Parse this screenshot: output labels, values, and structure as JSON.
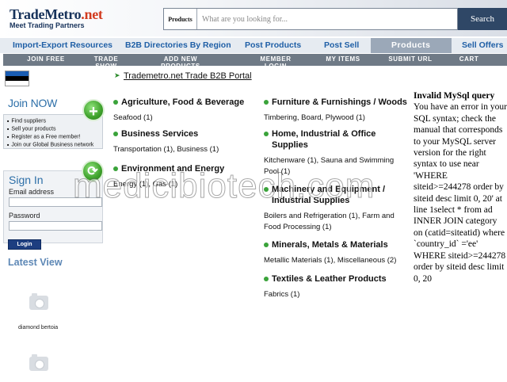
{
  "header": {
    "logo_main": "TradeMetro",
    "logo_dot": ".net",
    "tagline": "Meet Trading Partners",
    "search_category": "Products",
    "search_placeholder": "What are you looking for...",
    "search_button": "Search"
  },
  "nav_primary": [
    {
      "label": "Import-Export Resources",
      "active": false
    },
    {
      "label": "B2B Directories By Region",
      "active": false
    },
    {
      "label": "Post Products",
      "active": false
    },
    {
      "label": "Post Sell",
      "active": false
    },
    {
      "label": "Products",
      "active": true
    },
    {
      "label": "Sell Offers",
      "active": false
    }
  ],
  "nav_secondary": [
    "JOIN FREE",
    "TRADE SHOW",
    "ADD NEW PRODUCTS",
    "MEMBER LOGIN",
    "MY ITEMS",
    "SUBMIT URL",
    "CART"
  ],
  "breadcrumb": "Trademetro.net Trade B2B Portal",
  "flag_colors": [
    "#1a5db3",
    "#000000",
    "#ffffff"
  ],
  "sidebar": {
    "join_title": "Join NOW",
    "join_items": [
      "Find suppliers",
      "Sell your products",
      "Register as a Free member!",
      "Join our Global Business network"
    ],
    "signin_title": "Sign In",
    "email_label": "Email address",
    "password_label": "Password",
    "login_button": "Login",
    "latest_title": "Latest View",
    "latest_item": "diamond bertoia"
  },
  "categories_left": [
    {
      "title": "Agriculture, Food & Beverage",
      "sub": "Seafood (1)"
    },
    {
      "title": "Business Services",
      "sub": "Transportation (1), Business (1)"
    },
    {
      "title": "Environment and Energy",
      "sub": "Energy (1), Gas (1)"
    }
  ],
  "categories_right": [
    {
      "title": "Furniture & Furnishings / Woods",
      "sub": "Timbering, Board, Plywood (1)"
    },
    {
      "title": "Home, Industrial & Office Supplies",
      "sub": "Kitchenware (1), Sauna and Swimming Pool (1)"
    },
    {
      "title": "Machinery and Equipment / Industrial Supplies",
      "sub": "Boilers and Refrigeration (1), Farm and Food Processing (1)"
    },
    {
      "title": "Minerals, Metals & Materials",
      "sub": "Metallic Materials (1), Miscellaneous (2)"
    },
    {
      "title": "Textiles & Leather Products",
      "sub": "Fabrics (1)"
    }
  ],
  "error": {
    "title": "Invalid MySql query",
    "message": "You have an error in your SQL syntax; check the manual that corresponds to your MySQL server version for the right syntax to use near 'WHERE siteid>=244278 order by siteid desc limit 0, 20' at line 1select * from ad INNER JOIN category on (catid=siteatid) where `country_id` ='ee' WHERE siteid>=244278 order by siteid desc limit 0, 20"
  },
  "watermark": "medicibiotech.com",
  "colors": {
    "accent": "#1f5fa6",
    "nav_grey": "#6f7a86",
    "green_bullet": "#3aa33a",
    "search_button": "#2f4766"
  }
}
